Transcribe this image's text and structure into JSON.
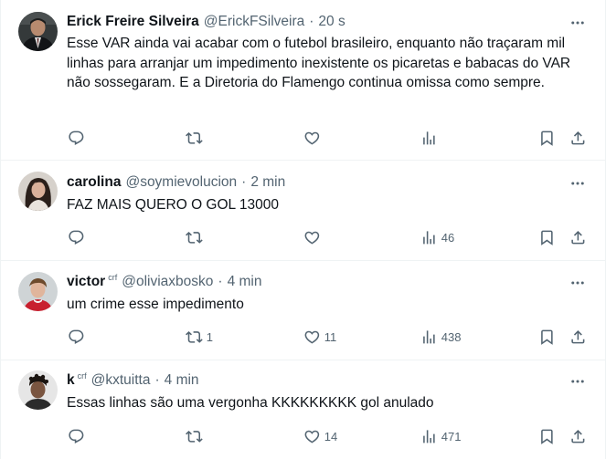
{
  "tweets": [
    {
      "name": "Erick Freire Silveira",
      "flair": "",
      "handle": "@ErickFSilveira",
      "time": "20 s",
      "text": "Esse VAR ainda vai acabar com o futebol brasileiro, enquanto não traçaram mil linhas para arranjar um impedimento inexistente os picaretas e babacas do VAR não sossegaram. E a Diretoria do Flamengo continua omissa como sempre.",
      "replies": "",
      "retweets": "",
      "likes": "",
      "views": ""
    },
    {
      "name": "carolina",
      "flair": "",
      "handle": "@soymievolucion",
      "time": "2 min",
      "text": "FAZ MAIS QUERO O GOL 13000",
      "replies": "",
      "retweets": "",
      "likes": "",
      "views": "46"
    },
    {
      "name": "victor",
      "flair": "crf",
      "handle": "@oliviaxbosko",
      "time": "4 min",
      "text": "um crime esse impedimento",
      "replies": "",
      "retweets": "1",
      "likes": "11",
      "views": "438"
    },
    {
      "name": "k",
      "flair": "crf",
      "handle": "@kxtuitta",
      "time": "4 min",
      "text": "Essas linhas são uma vergonha KKKKKKKKK gol anulado",
      "replies": "",
      "retweets": "",
      "likes": "14",
      "views": "471"
    }
  ],
  "separator": "·",
  "colors": {
    "text_primary": "#0f1419",
    "text_secondary": "#536471",
    "divider": "#eff3f4"
  },
  "icons": {
    "reply": "reply-icon",
    "retweet": "retweet-icon",
    "like": "like-icon",
    "views": "views-icon",
    "bookmark": "bookmark-icon",
    "share": "share-icon",
    "more": "more-icon"
  }
}
